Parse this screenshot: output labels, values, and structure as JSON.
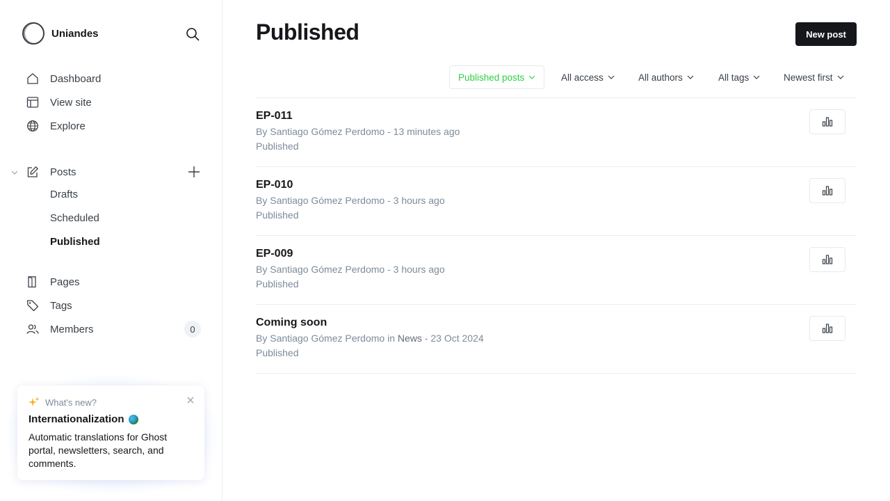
{
  "sidebar": {
    "site_name": "Uniandes",
    "nav": {
      "dashboard": "Dashboard",
      "view_site": "View site",
      "explore": "Explore",
      "posts": "Posts",
      "drafts": "Drafts",
      "scheduled": "Scheduled",
      "published": "Published",
      "pages": "Pages",
      "tags": "Tags",
      "members": "Members",
      "members_count": "0"
    },
    "whats_new": {
      "header": "What's new?",
      "title": "Internationalization",
      "body": "Automatic translations for Ghost portal, newsletters, search, and comments."
    }
  },
  "main": {
    "title": "Published",
    "new_post_label": "New post",
    "filters": {
      "type": "Published posts",
      "access": "All access",
      "authors": "All authors",
      "tags": "All tags",
      "order": "Newest first"
    },
    "posts": [
      {
        "title": "EP-011",
        "meta_prefix": "By Santiago Gómez Perdomo",
        "meta_tag_prefix": "",
        "tag": "",
        "meta_suffix": " - 13 minutes ago",
        "status": "Published"
      },
      {
        "title": "EP-010",
        "meta_prefix": "By Santiago Gómez Perdomo",
        "meta_tag_prefix": "",
        "tag": "",
        "meta_suffix": " - 3 hours ago",
        "status": "Published"
      },
      {
        "title": "EP-009",
        "meta_prefix": "By Santiago Gómez Perdomo",
        "meta_tag_prefix": "",
        "tag": "",
        "meta_suffix": " - 3 hours ago",
        "status": "Published"
      },
      {
        "title": "Coming soon",
        "meta_prefix": "By Santiago Gómez Perdomo",
        "meta_tag_prefix": " in ",
        "tag": "News",
        "meta_suffix": " - 23 Oct 2024",
        "status": "Published"
      }
    ]
  },
  "colors": {
    "accent_green": "#30cf43",
    "text_primary": "#15171a",
    "text_muted": "#7c8b9a"
  },
  "icons": [
    "search-icon",
    "home-icon",
    "layout-icon",
    "globe-icon",
    "edit-icon",
    "plus-icon",
    "chevron-down-icon",
    "page-icon",
    "tag-icon",
    "members-icon",
    "sparkle-icon",
    "close-icon",
    "stats-icon"
  ]
}
